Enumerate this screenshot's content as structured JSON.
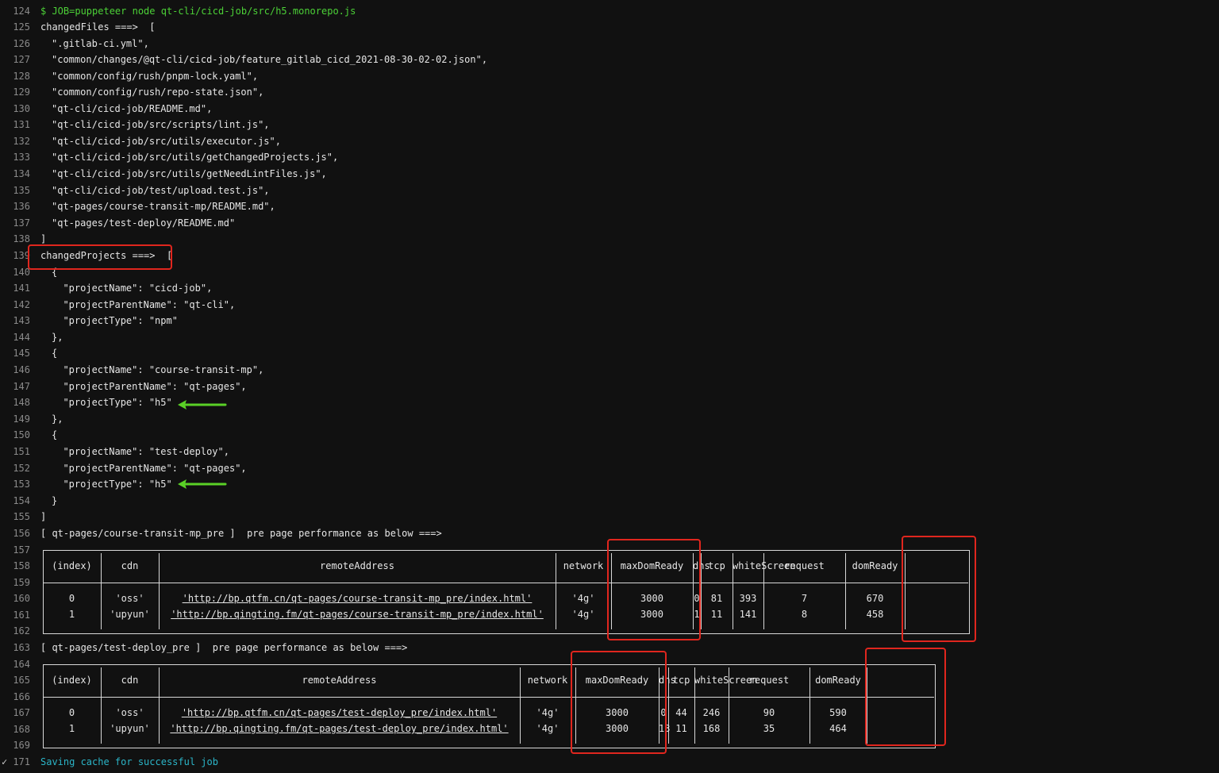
{
  "terminal": {
    "line_numbers": [
      "124",
      "125",
      "126",
      "127",
      "128",
      "129",
      "130",
      "131",
      "132",
      "133",
      "134",
      "135",
      "136",
      "137",
      "138",
      "139",
      "140",
      "141",
      "142",
      "143",
      "144",
      "145",
      "146",
      "147",
      "148",
      "149",
      "150",
      "151",
      "152",
      "153",
      "154",
      "155",
      "156",
      "157",
      "158",
      "159",
      "160",
      "161",
      "162",
      "163",
      "164",
      "165",
      "166",
      "167",
      "168",
      "169",
      "171"
    ],
    "command": "$ JOB=puppeteer node qt-cli/cicd-job/src/h5.monorepo.js",
    "changed_files_header": "changedFiles ===>  [",
    "changed_files": [
      "\".gitlab-ci.yml\",",
      "\"common/changes/@qt-cli/cicd-job/feature_gitlab_cicd_2021-08-30-02-02.json\",",
      "\"common/config/rush/pnpm-lock.yaml\",",
      "\"common/config/rush/repo-state.json\",",
      "\"qt-cli/cicd-job/README.md\",",
      "\"qt-cli/cicd-job/src/scripts/lint.js\",",
      "\"qt-cli/cicd-job/src/utils/executor.js\",",
      "\"qt-cli/cicd-job/src/utils/getChangedProjects.js\",",
      "\"qt-cli/cicd-job/src/utils/getNeedLintFiles.js\",",
      "\"qt-cli/cicd-job/test/upload.test.js\",",
      "\"qt-pages/course-transit-mp/README.md\",",
      "\"qt-pages/test-deploy/README.md\""
    ],
    "close_bracket": "]",
    "changed_projects_header": "changedProjects ===>  [",
    "projects_lines": [
      "{",
      "  \"projectName\": \"cicd-job\",",
      "  \"projectParentName\": \"qt-cli\",",
      "  \"projectType\": \"npm\"",
      "},",
      "{",
      "  \"projectName\": \"course-transit-mp\",",
      "  \"projectParentName\": \"qt-pages\",",
      "  \"projectType\": \"h5\"",
      "},",
      "{",
      "  \"projectName\": \"test-deploy\",",
      "  \"projectParentName\": \"qt-pages\",",
      "  \"projectType\": \"h5\"",
      "}"
    ],
    "table1_title": "[ qt-pages/course-transit-mp_pre ]  pre page performance as below ===>",
    "table2_title": "[ qt-pages/test-deploy_pre ]  pre page performance as below ===>",
    "footer": "Saving cache for successful job",
    "footer_prefix": "✓"
  },
  "table_columns": [
    "(index)",
    "cdn",
    "remoteAddress",
    "network",
    "maxDomReady",
    "dns",
    "tcp",
    "whiteScreen",
    "request",
    "domReady"
  ],
  "table1_rows": [
    [
      "0",
      "'oss'",
      "'http://bp.qtfm.cn/qt-pages/course-transit-mp_pre/index.html'",
      "'4g'",
      "3000",
      "0",
      "81",
      "393",
      "7",
      "670"
    ],
    [
      "1",
      "'upyun'",
      "'http://bp.qingting.fm/qt-pages/course-transit-mp_pre/index.html'",
      "'4g'",
      "3000",
      "1",
      "11",
      "141",
      "8",
      "458"
    ]
  ],
  "table2_rows": [
    [
      "0",
      "'oss'",
      "'http://bp.qtfm.cn/qt-pages/test-deploy_pre/index.html'",
      "'4g'",
      "3000",
      "0",
      "44",
      "246",
      "90",
      "590"
    ],
    [
      "1",
      "'upyun'",
      "'http://bp.qingting.fm/qt-pages/test-deploy_pre/index.html'",
      "'4g'",
      "3000",
      "13",
      "11",
      "168",
      "35",
      "464"
    ]
  ],
  "colors": {
    "background": "#111111",
    "command_green": "#4cd137",
    "info_cyan": "#2bb5c8",
    "highlight_red": "#e0261e",
    "arrow_green": "#5ad126"
  }
}
